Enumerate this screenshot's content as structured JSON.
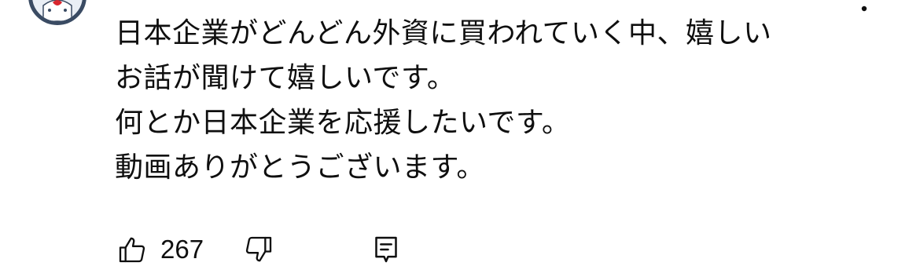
{
  "comment": {
    "lines": [
      "日本企業がどんどん外資に買われていく中、嬉しい",
      "お話が聞けて嬉しいです。",
      "何とか日本企業を応援したいです。",
      "動画ありがとうございます。"
    ]
  },
  "actions": {
    "like_count": "267",
    "like_icon": "thumbs-up-icon",
    "dislike_icon": "thumbs-down-icon",
    "reply_icon": "reply-comment-icon"
  },
  "menu": {
    "icon": "more-vertical-icon"
  },
  "colors": {
    "text": "#0f0f0f",
    "avatar_ring": "#3a4b63",
    "avatar_accent": "#d8262e"
  }
}
